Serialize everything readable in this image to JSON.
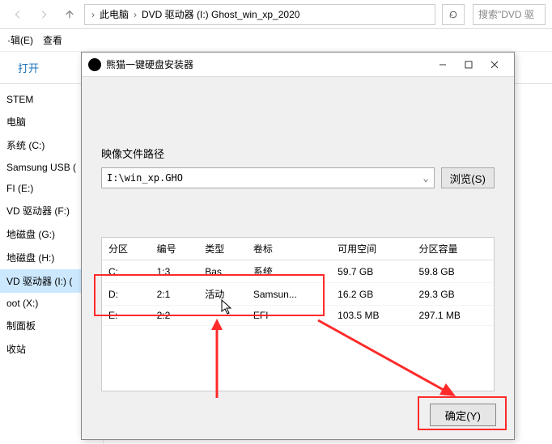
{
  "explorer": {
    "breadcrumb": {
      "pc": "此电脑",
      "drive": "DVD 驱动器 (I:) Ghost_win_xp_2020"
    },
    "search_placeholder": "搜索\"DVD 驱"
  },
  "menu": {
    "edit": "·辑(E)",
    "view": "查看"
  },
  "toolbar": {
    "open": "打开"
  },
  "sidebar": {
    "items": [
      "STEM",
      "电脑",
      "系统 (C:)",
      "Samsung USB (",
      "FI (E:)",
      "VD 驱动器 (F:)",
      "地磁盘 (G:)",
      "地磁盘 (H:)",
      "VD 驱动器 (I:) (",
      "oot (X:)",
      "制面板",
      "收站"
    ],
    "selected_index": 8
  },
  "dialog": {
    "title": "熊猫一键硬盘安装器",
    "section_label": "映像文件路径",
    "image_path": "I:\\win_xp.GHO",
    "browse_label": "浏览(S)",
    "columns": {
      "part": "分区",
      "id": "编号",
      "type": "类型",
      "vol": "卷标",
      "free": "可用空间",
      "total": "分区容量"
    },
    "rows": [
      {
        "part": "C:",
        "id": "1:3",
        "type": "Bas",
        "vol": "系统",
        "free": "59.7 GB",
        "total": "59.8 GB"
      },
      {
        "part": "D:",
        "id": "2:1",
        "type": "活动",
        "vol": "Samsun...",
        "free": "16.2 GB",
        "total": "29.3 GB"
      },
      {
        "part": "E:",
        "id": "2:2",
        "type": "",
        "vol": "EFI",
        "free": "103.5 MB",
        "total": "297.1 MB"
      }
    ],
    "ok_label": "确定(Y)"
  }
}
